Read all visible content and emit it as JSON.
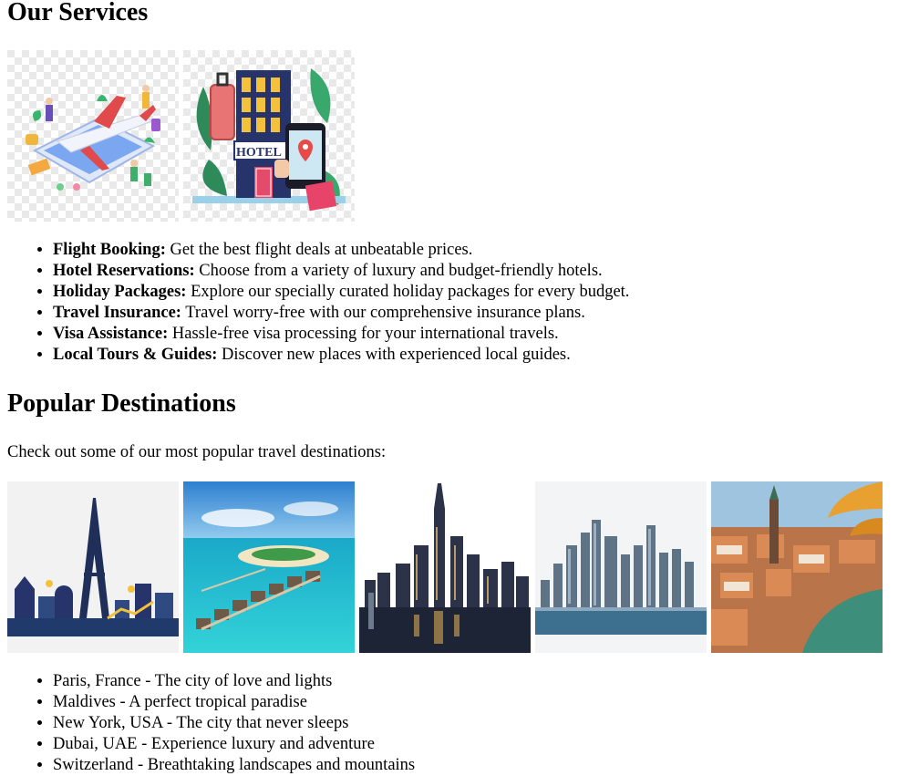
{
  "services": {
    "heading": "Our Services",
    "images": [
      {
        "icon": "flight-booking-illustration"
      },
      {
        "icon": "hotel-illustration",
        "sign_text": "HOTEL"
      }
    ],
    "items": [
      {
        "title": "Flight Booking:",
        "text": " Get the best flight deals at unbeatable prices."
      },
      {
        "title": "Hotel Reservations:",
        "text": " Choose from a variety of luxury and budget-friendly hotels."
      },
      {
        "title": "Holiday Packages:",
        "text": " Explore our specially curated holiday packages for every budget."
      },
      {
        "title": "Travel Insurance:",
        "text": " Travel worry-free with our comprehensive insurance plans."
      },
      {
        "title": "Visa Assistance:",
        "text": " Hassle-free visa processing for your international travels."
      },
      {
        "title": "Local Tours & Guides:",
        "text": " Discover new places with experienced local guides."
      }
    ]
  },
  "destinations": {
    "heading": "Popular Destinations",
    "intro": "Check out some of our most popular travel destinations:",
    "images": [
      {
        "icon": "paris-skyline-illustration"
      },
      {
        "icon": "maldives-photo"
      },
      {
        "icon": "new-york-skyline-photo"
      },
      {
        "icon": "dubai-skyline-photo"
      },
      {
        "icon": "switzerland-city-photo"
      }
    ],
    "items": [
      "Paris, France - The city of love and lights",
      "Maldives - A perfect tropical paradise",
      "New York, USA - The city that never sleeps",
      "Dubai, UAE - Experience luxury and adventure",
      "Switzerland - Breathtaking landscapes and mountains"
    ]
  }
}
